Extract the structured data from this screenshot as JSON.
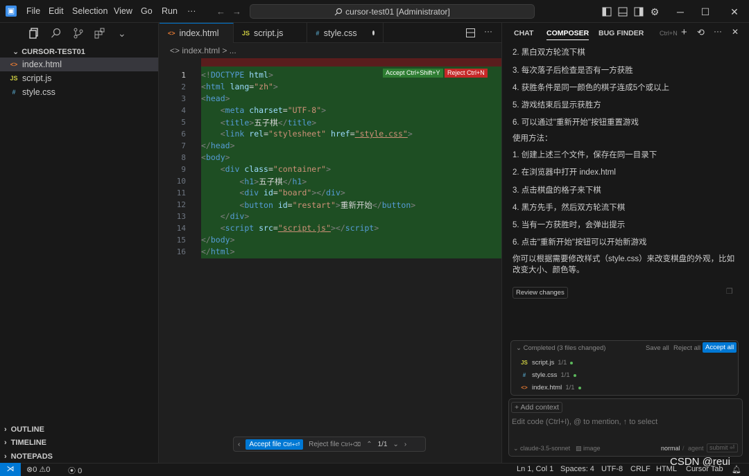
{
  "titlebar": {
    "logo": "▣",
    "menus": [
      "File",
      "Edit",
      "Selection",
      "View",
      "Go",
      "Run"
    ],
    "more": "···",
    "search": "cursor-test01 [Administrator]"
  },
  "sidebar": {
    "explorer_title": "CURSOR-TEST01",
    "files": [
      {
        "icon": "<>",
        "name": "index.html",
        "color": "#e37933"
      },
      {
        "icon": "JS",
        "name": "script.js",
        "color": "#cbcb41"
      },
      {
        "icon": "#",
        "name": "style.css",
        "color": "#519aba"
      }
    ],
    "sections": [
      "OUTLINE",
      "TIMELINE",
      "NOTEPADS"
    ]
  },
  "tabs": [
    {
      "icon": "<>",
      "label": "index.html",
      "color": "#e37933"
    },
    {
      "icon": "JS",
      "label": "script.js",
      "color": "#cbcb41"
    },
    {
      "icon": "#",
      "label": "style.css",
      "color": "#519aba"
    }
  ],
  "breadcrumb": "<> index.html > ...",
  "editor": {
    "accept": "Accept Ctrl+Shift+Y",
    "reject": "Reject Ctrl+N",
    "line_numbers": [
      "1",
      "2",
      "3",
      "4",
      "5",
      "6",
      "7",
      "8",
      "9",
      "10",
      "11",
      "12",
      "13",
      "14",
      "15",
      "16"
    ],
    "review_bar": {
      "accept_file": "Accept file",
      "accept_key": "Ctrl+⏎",
      "reject_file": "Reject file",
      "reject_key": "Ctrl+⌫",
      "counter": "1/1"
    }
  },
  "panel": {
    "tabs": [
      "CHAT",
      "COMPOSER",
      "BUG FINDER"
    ],
    "shortcut": "Ctrl+N",
    "messages": [
      "2. 黑白双方轮流下棋",
      "3. 每次落子后检查是否有一方获胜",
      "4. 获胜条件是同一颜色的棋子连成5个或以上",
      "5. 游戏结束后显示获胜方",
      "6. 可以通过\"重新开始\"按钮重置游戏",
      "使用方法：",
      "1. 创建上述三个文件，保存在同一目录下",
      "2. 在浏览器中打开 index.html",
      "3. 点击棋盘的格子来下棋",
      "4. 黑方先手，然后双方轮流下棋",
      "5. 当有一方获胜时，会弹出提示",
      "6. 点击\"重新开始\"按钮可以开始新游戏",
      "你可以根据需要修改样式（style.css）来改变棋盘的外观，比如改变大小、颜色等。"
    ],
    "review_changes": "Review changes",
    "completed": "Completed (3 files changed)",
    "save_all": "Save all",
    "reject_all": "Reject all",
    "accept_all": "Accept all",
    "changed_files": [
      {
        "icon": "JS",
        "name": "script.js",
        "count": "1/1",
        "color": "#cbcb41"
      },
      {
        "icon": "#",
        "name": "style.css",
        "count": "1/1",
        "color": "#519aba"
      },
      {
        "icon": "<>",
        "name": "index.html",
        "count": "1/1",
        "color": "#e37933"
      }
    ],
    "add_context": "+ Add context",
    "input_placeholder": "Edit code (Ctrl+I), @ to mention, ↑ to select",
    "model": "claude-3.5-sonnet",
    "image": "image",
    "mode_normal": "normal",
    "mode_agent": "agent",
    "submit": "submit"
  },
  "statusbar": {
    "errors": "0",
    "warnings": "0",
    "ports": "0",
    "position": "Ln 1, Col 1",
    "spaces": "Spaces: 4",
    "encoding": "UTF-8",
    "eol": "CRLF",
    "language": "HTML",
    "cursor_tab": "Cursor Tab",
    "watermark": "CSDN @reui"
  },
  "colors": {
    "accent": "#0078d4",
    "diff_added": "#1e4e23",
    "diff_removed": "#5a1d1d"
  }
}
